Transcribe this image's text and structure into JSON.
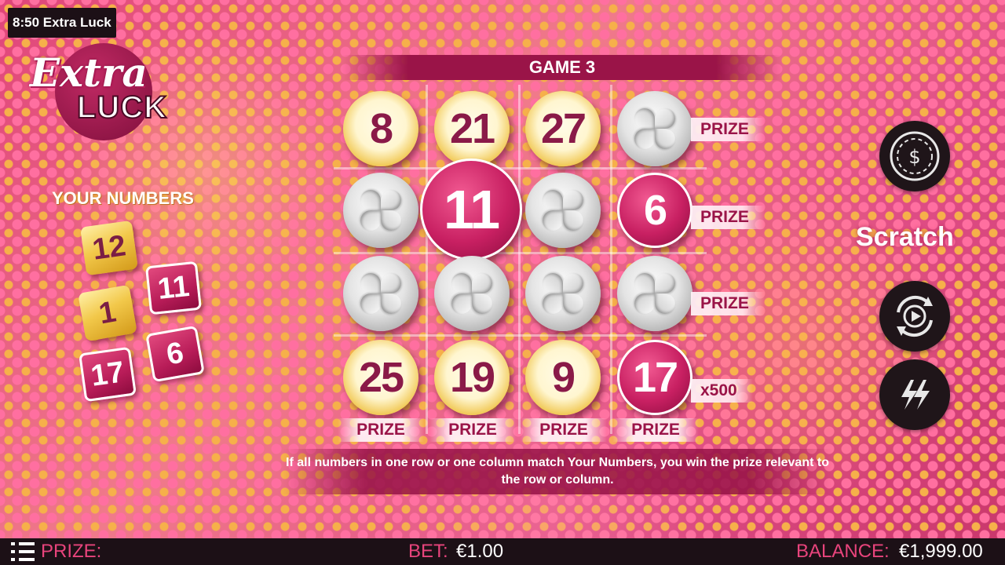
{
  "clock_title": "8:50 Extra Luck",
  "logo": {
    "line1": "Extra",
    "line2": "LUCK"
  },
  "your_numbers": {
    "title": "YOUR NUMBERS",
    "tiles": [
      {
        "value": "12",
        "style": "gold"
      },
      {
        "value": "1",
        "style": "gold"
      },
      {
        "value": "11",
        "style": "pink"
      },
      {
        "value": "17",
        "style": "pink"
      },
      {
        "value": "6",
        "style": "pink"
      }
    ]
  },
  "board": {
    "title": "GAME 3",
    "rows": [
      {
        "cells": [
          {
            "value": "8",
            "state": "gold"
          },
          {
            "value": "21",
            "state": "gold"
          },
          {
            "value": "27",
            "state": "gold"
          },
          {
            "value": "",
            "state": "unscratched"
          }
        ],
        "prize": "PRIZE"
      },
      {
        "cells": [
          {
            "value": "",
            "state": "unscratched"
          },
          {
            "value": "11",
            "state": "match-highlight"
          },
          {
            "value": "",
            "state": "unscratched"
          },
          {
            "value": "6",
            "state": "match"
          }
        ],
        "prize": "PRIZE"
      },
      {
        "cells": [
          {
            "value": "",
            "state": "unscratched"
          },
          {
            "value": "",
            "state": "unscratched"
          },
          {
            "value": "",
            "state": "unscratched"
          },
          {
            "value": "",
            "state": "unscratched"
          }
        ],
        "prize": "PRIZE"
      },
      {
        "cells": [
          {
            "value": "25",
            "state": "gold"
          },
          {
            "value": "19",
            "state": "gold"
          },
          {
            "value": "9",
            "state": "gold"
          },
          {
            "value": "17",
            "state": "match"
          }
        ],
        "prize": "x500"
      }
    ],
    "column_prizes": [
      "PRIZE",
      "PRIZE",
      "PRIZE",
      "PRIZE"
    ],
    "info": "If all numbers in one row or one column match Your Numbers, you win the prize relevant to the row or column."
  },
  "controls": {
    "bet_icon": "dollar-chip-icon",
    "scratch_label": "Scratch",
    "autoplay_icon": "autoplay-icon",
    "turbo_icon": "lightning-icon"
  },
  "footer": {
    "prize_label": "PRIZE:",
    "prize_value": "",
    "bet_label": "BET:",
    "bet_value": "€1.00",
    "balance_label": "BALANCE:",
    "balance_value": "€1,999.00"
  },
  "colors": {
    "brand": "#9a1448",
    "accent_pink": "#e8447c",
    "gold": "#f2c84a",
    "bar": "#1c1016"
  }
}
